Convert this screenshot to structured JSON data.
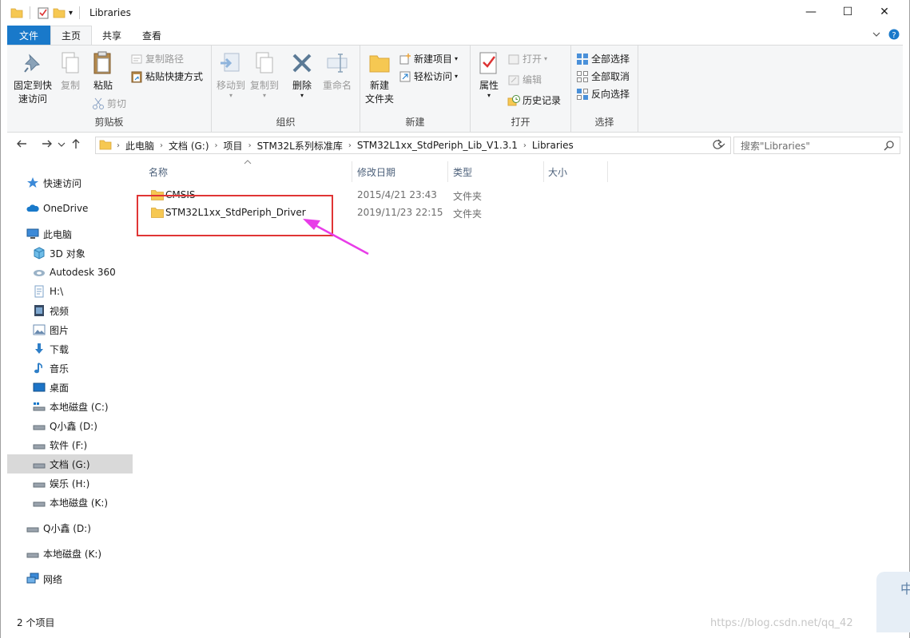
{
  "window": {
    "title": "Libraries",
    "minimize_glyph": "—",
    "maximize_glyph": "☐",
    "close_glyph": "✕"
  },
  "quick_access_toolbar": {
    "dropdown_glyph": "▾"
  },
  "ribbon_tabs": {
    "file": "文件",
    "home": "主页",
    "share": "共享",
    "view": "查看"
  },
  "ribbon": {
    "clipboard": {
      "group": "剪贴板",
      "pin_line1": "固定到快",
      "pin_line2": "速访问",
      "copy": "复制",
      "paste": "粘贴",
      "copy_path": "复制路径",
      "paste_shortcut": "粘贴快捷方式",
      "cut": "剪切"
    },
    "organize": {
      "group": "组织",
      "move_to": "移动到",
      "copy_to": "复制到",
      "delete": "删除",
      "rename": "重命名"
    },
    "new": {
      "group": "新建",
      "new_folder_line1": "新建",
      "new_folder_line2": "文件夹",
      "new_item": "新建项目",
      "easy_access": "轻松访问"
    },
    "open": {
      "group": "打开",
      "properties": "属性",
      "open": "打开",
      "edit": "编辑",
      "history": "历史记录"
    },
    "select": {
      "group": "选择",
      "select_all": "全部选择",
      "select_none": "全部取消",
      "invert": "反向选择"
    }
  },
  "address_bar": {
    "breadcrumbs": [
      "此电脑",
      "文档 (G:)",
      "项目",
      "STM32L系列标准库",
      "STM32L1xx_StdPeriph_Lib_V1.3.1",
      "Libraries"
    ],
    "search_placeholder": "搜索\"Libraries\""
  },
  "nav_pane": {
    "items": [
      {
        "label": "快速访问",
        "icon": "star-icon"
      },
      {
        "label": "OneDrive",
        "icon": "cloud-icon"
      },
      {
        "label": "此电脑",
        "icon": "computer-icon"
      },
      {
        "label": "3D 对象",
        "icon": "cube-icon"
      },
      {
        "label": "Autodesk 360",
        "icon": "autodesk-icon"
      },
      {
        "label": "H:\\",
        "icon": "document-icon"
      },
      {
        "label": "视频",
        "icon": "video-icon"
      },
      {
        "label": "图片",
        "icon": "picture-icon"
      },
      {
        "label": "下载",
        "icon": "download-icon"
      },
      {
        "label": "音乐",
        "icon": "music-icon"
      },
      {
        "label": "桌面",
        "icon": "desktop-icon"
      },
      {
        "label": "本地磁盘 (C:)",
        "icon": "drive-icon"
      },
      {
        "label": "Q小鑫 (D:)",
        "icon": "drive-icon"
      },
      {
        "label": "软件 (F:)",
        "icon": "drive-icon"
      },
      {
        "label": "文档 (G:)",
        "icon": "drive-icon",
        "selected": true
      },
      {
        "label": "娱乐 (H:)",
        "icon": "drive-icon"
      },
      {
        "label": "本地磁盘 (K:)",
        "icon": "drive-icon"
      },
      {
        "label": "Q小鑫 (D:)",
        "icon": "drive-icon"
      },
      {
        "label": "本地磁盘 (K:)",
        "icon": "drive-icon"
      },
      {
        "label": "网络",
        "icon": "network-icon"
      }
    ]
  },
  "file_list": {
    "columns": {
      "name": "名称",
      "modified": "修改日期",
      "type": "类型",
      "size": "大小"
    },
    "rows": [
      {
        "name": "CMSIS",
        "modified": "2015/4/21 23:43",
        "type": "文件夹"
      },
      {
        "name": "STM32L1xx_StdPeriph_Driver",
        "modified": "2019/11/23 22:15",
        "type": "文件夹"
      }
    ]
  },
  "status_bar": {
    "item_count": "2 个项目"
  },
  "watermark": "https://blog.csdn.net/qq_42",
  "side_widget_glyph": "中",
  "colors": {
    "accent": "#1979ca",
    "annotation_box": "#e03535",
    "annotation_arrow": "#e83ce8",
    "folder": "#f6c852"
  }
}
